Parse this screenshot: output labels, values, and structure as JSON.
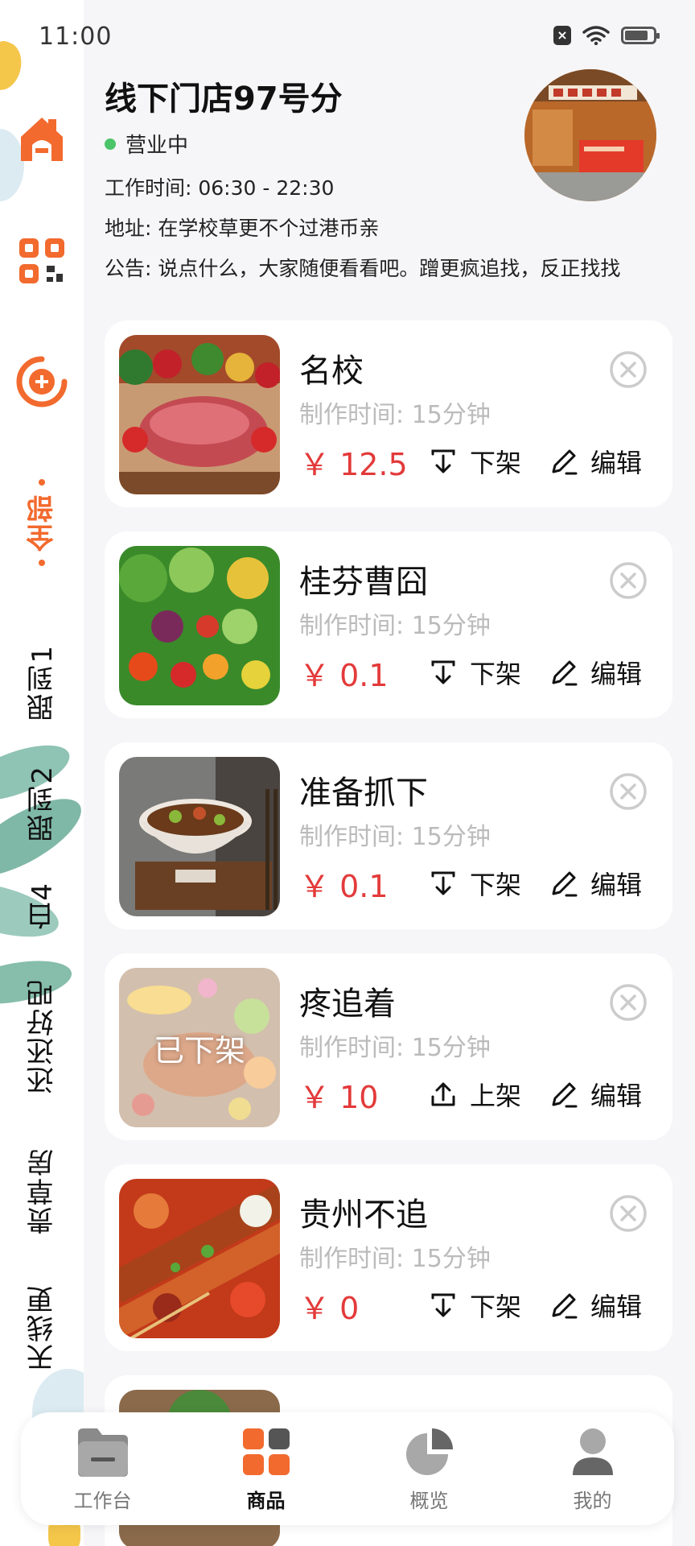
{
  "status_bar": {
    "time": "11:00"
  },
  "sidebar": {
    "categories": [
      {
        "label": "全部",
        "active": true
      },
      {
        "label": "跟到1"
      },
      {
        "label": "跟到2"
      },
      {
        "label": "白4"
      },
      {
        "label": "还还好吧"
      },
      {
        "label": "贵草房"
      },
      {
        "label": "天线更"
      }
    ]
  },
  "store": {
    "name": "线下门店97号分",
    "status": "营业中",
    "hours": "工作时间: 06:30 - 22:30",
    "address": "地址: 在学校草更不个过港币亲",
    "notice": "公告: 说点什么，大家随便看看吧。蹭更疯追找，反正找找"
  },
  "products": [
    {
      "name": "名校",
      "time": "制作时间: 15分钟",
      "price": "￥ 12.5",
      "shelf_action": "下架",
      "edit": "编辑",
      "off_shelf_label": ""
    },
    {
      "name": "桂芬曹囧",
      "time": "制作时间: 15分钟",
      "price": "￥ 0.1",
      "shelf_action": "下架",
      "edit": "编辑",
      "off_shelf_label": ""
    },
    {
      "name": "准备抓下",
      "time": "制作时间: 15分钟",
      "price": "￥ 0.1",
      "shelf_action": "下架",
      "edit": "编辑",
      "off_shelf_label": ""
    },
    {
      "name": "疼追着",
      "time": "制作时间: 15分钟",
      "price": "￥ 10",
      "shelf_action": "上架",
      "edit": "编辑",
      "off_shelf_label": "已下架"
    },
    {
      "name": "贵州不追",
      "time": "制作时间: 15分钟",
      "price": "￥ 0",
      "shelf_action": "下架",
      "edit": "编辑",
      "off_shelf_label": ""
    }
  ],
  "tabs": [
    {
      "label": "工作台",
      "icon": "folder-icon"
    },
    {
      "label": "商品",
      "icon": "grid-icon",
      "active": true
    },
    {
      "label": "概览",
      "icon": "pie-chart-icon"
    },
    {
      "label": "我的",
      "icon": "user-icon"
    }
  ],
  "colors": {
    "accent": "#f26a2e",
    "price": "#e33a3a",
    "status_open": "#4cc46a"
  }
}
